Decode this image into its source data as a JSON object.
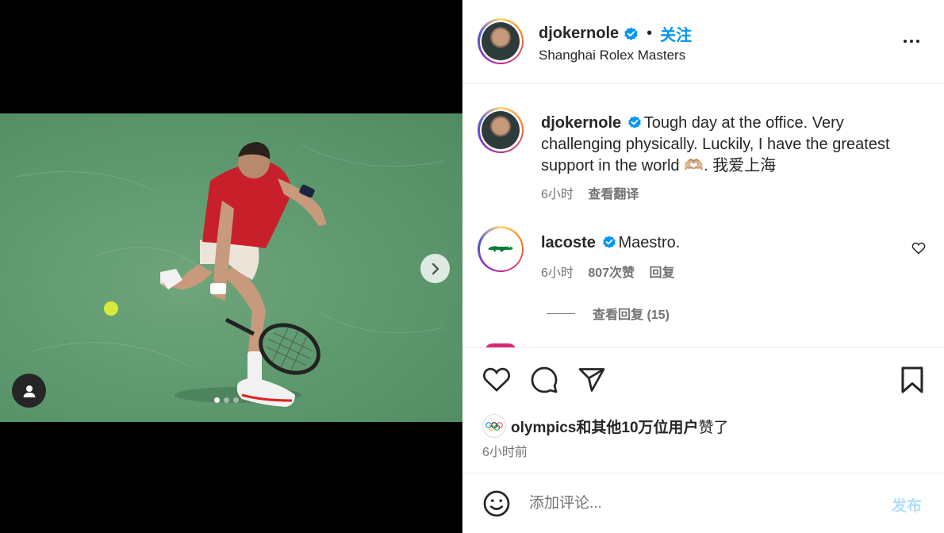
{
  "post": {
    "username": "djokernole",
    "follow_label": "关注",
    "location": "Shanghai Rolex Masters",
    "more_icon": "more-horizontal-icon"
  },
  "media": {
    "photo_description_icon": "tennis-photo",
    "carousel_dots": 3,
    "active_dot": 0
  },
  "caption": {
    "username": "djokernole",
    "text": "Tough day at the office. Very challenging physically. Luckily, I have the greatest support in the world 🫶🏼. 我爱上海",
    "time": "6小时",
    "translate_label": "查看翻译"
  },
  "comments": [
    {
      "username": "lacoste",
      "text": "Maestro.",
      "time": "6小时",
      "likes_label": "807次赞",
      "reply_label": "回复",
      "view_replies_label": "查看回复 (15)"
    }
  ],
  "likes": {
    "account": "olympics",
    "text_bold": "和其他10万位用户",
    "text_suffix": "赞了"
  },
  "post_time": "6小时前",
  "comment_box": {
    "placeholder": "添加评论...",
    "post_label": "发布"
  },
  "colors": {
    "accent": "#0095f6",
    "post_disabled": "#b2dffc",
    "shirt": "#c8202a",
    "court": "#5f9a6f"
  }
}
